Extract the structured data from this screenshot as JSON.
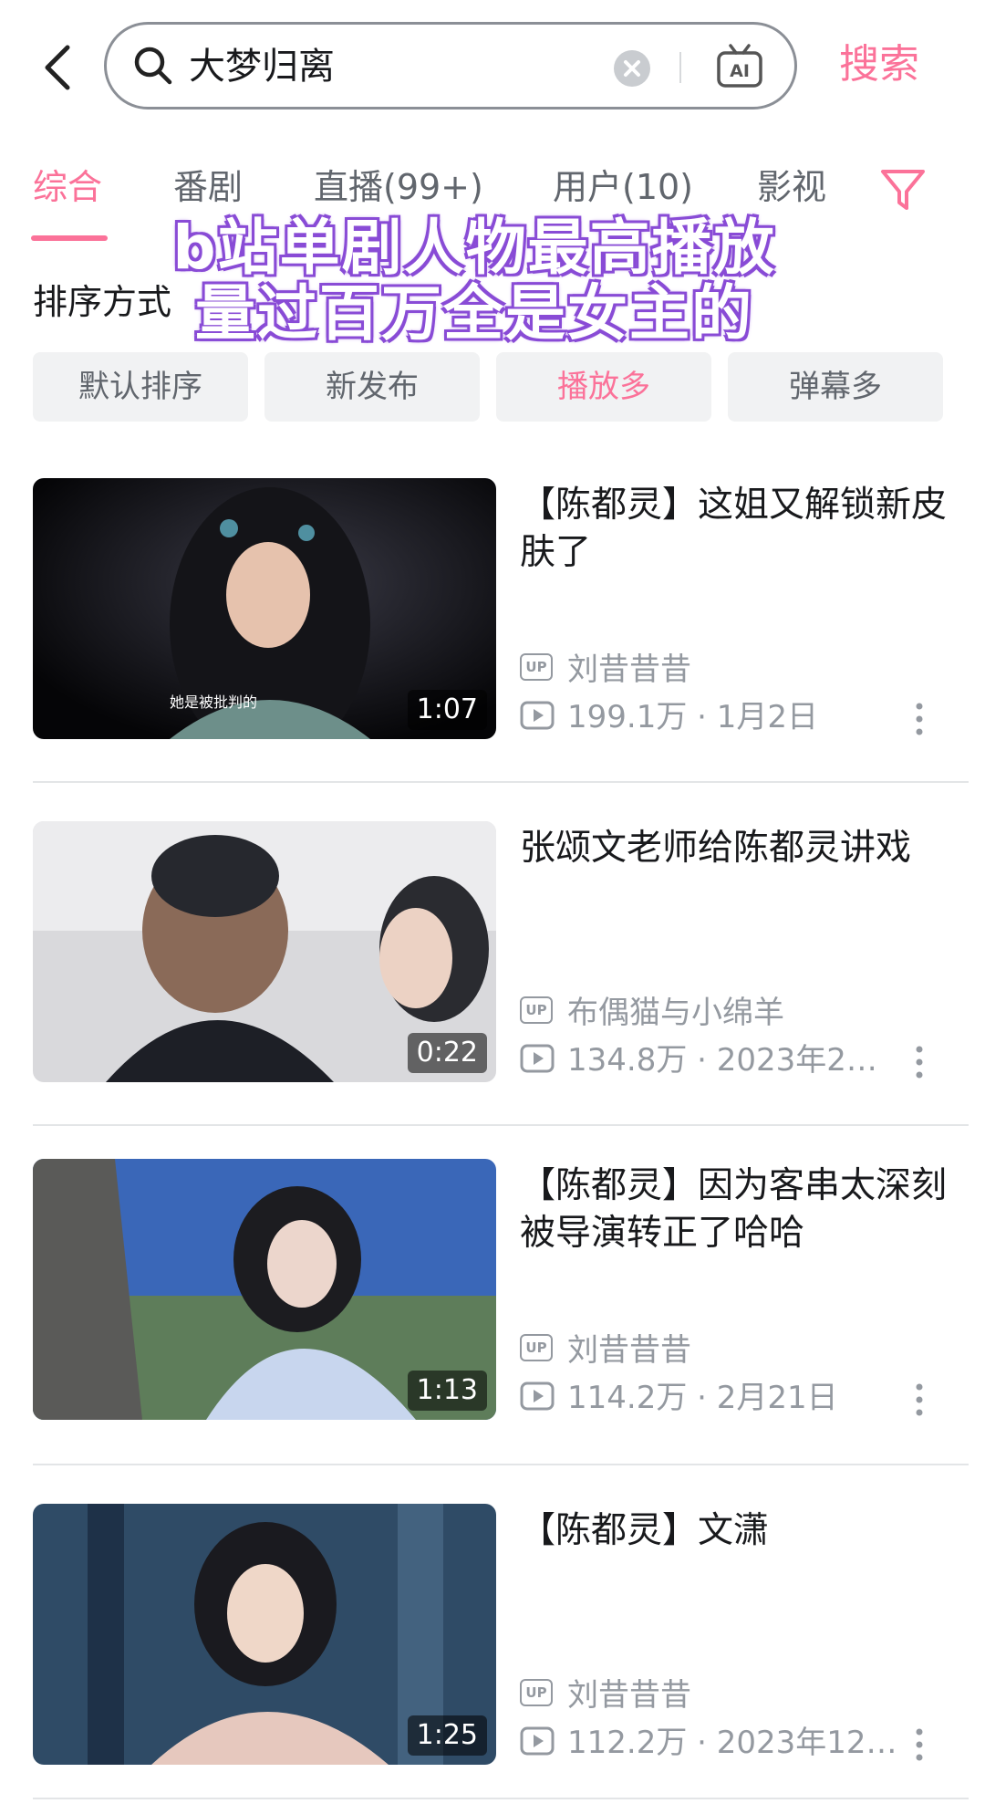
{
  "search": {
    "query": "大梦归离",
    "ai_label": "AI",
    "submit_label": "搜索"
  },
  "tabs": [
    {
      "label": "综合",
      "active": true
    },
    {
      "label": "番剧"
    },
    {
      "label": "直播(99+)"
    },
    {
      "label": "用户(10)"
    },
    {
      "label": "影视"
    }
  ],
  "overlay_caption": [
    "b站单剧人物最高播放",
    "量过百万全是女主的"
  ],
  "sort": {
    "label": "排序方式",
    "options": [
      {
        "label": "默认排序"
      },
      {
        "label": "新发布"
      },
      {
        "label": "播放多",
        "active": true
      },
      {
        "label": "弹幕多"
      }
    ]
  },
  "videos": [
    {
      "title": "【陈都灵】这姐又解锁新皮肤了",
      "duration": "1:07",
      "thumb_caption": "她是被批判的",
      "uploader": "刘昔昔昔",
      "stats": "199.1万 · 1月2日"
    },
    {
      "title": "张颂文老师给陈都灵讲戏",
      "duration": "0:22",
      "thumb_caption": "",
      "uploader": "布偶猫与小绵羊",
      "stats": "134.8万 · 2023年2…"
    },
    {
      "title": "【陈都灵】因为客串太深刻被导演转正了哈哈",
      "duration": "1:13",
      "thumb_caption": "",
      "uploader": "刘昔昔昔",
      "stats": "114.2万 · 2月21日"
    },
    {
      "title": "【陈都灵】文潇",
      "duration": "1:25",
      "thumb_caption": "",
      "uploader": "刘昔昔昔",
      "stats": "112.2万 · 2023年12…"
    }
  ],
  "badges": {
    "up": "UP"
  },
  "colors": {
    "accent": "#fb7299",
    "overlay_stroke": "#8a4dd6"
  }
}
